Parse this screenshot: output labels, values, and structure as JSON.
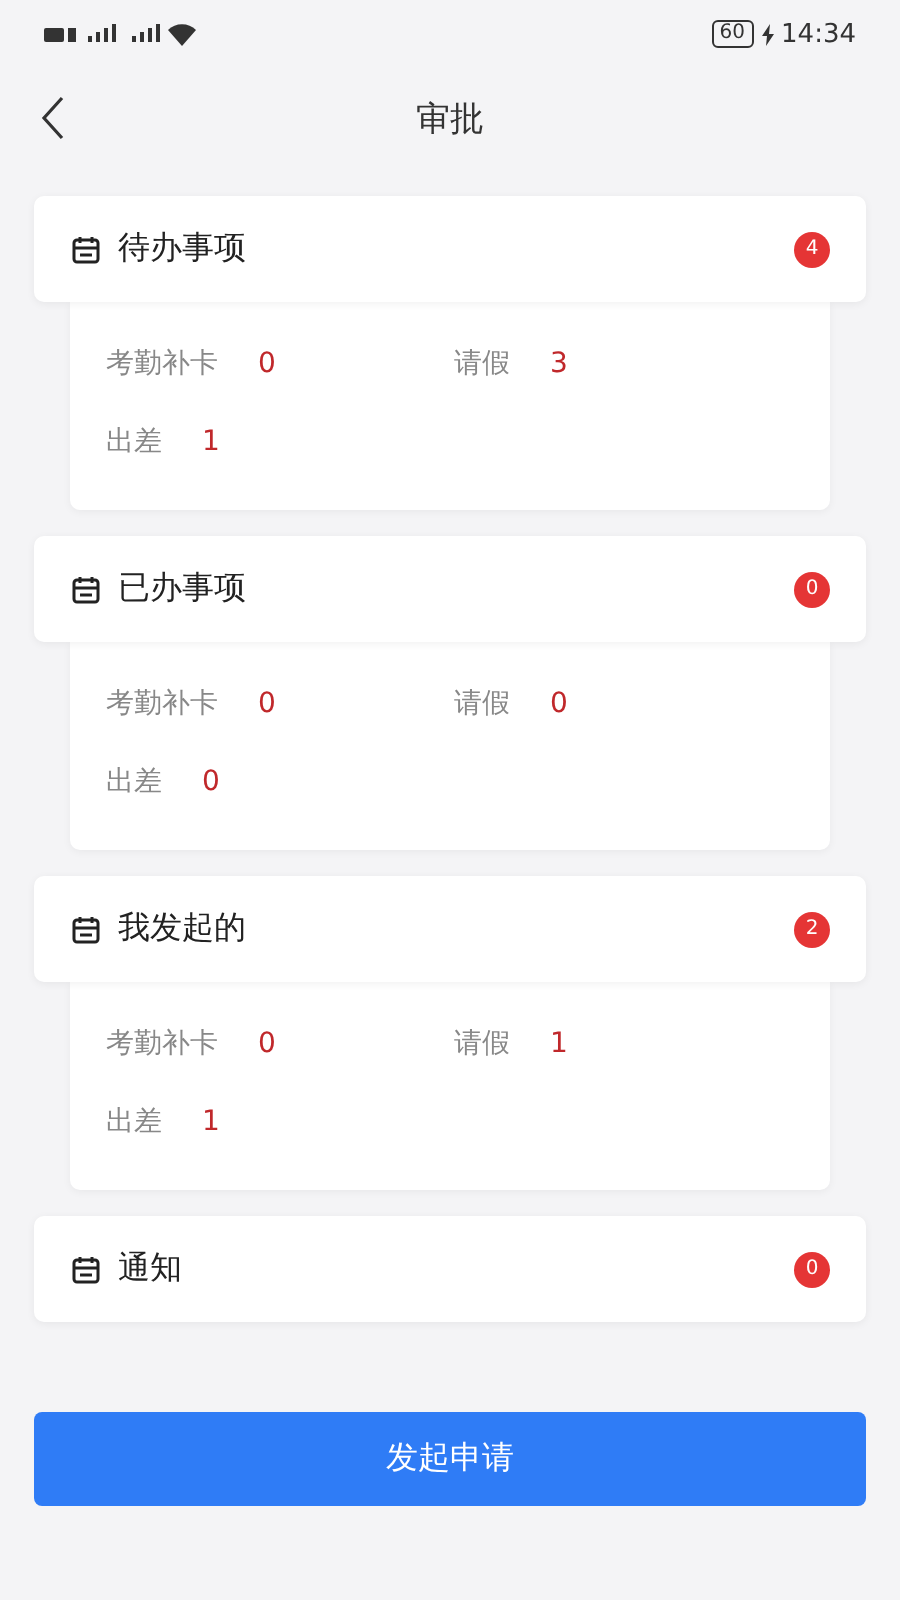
{
  "status_bar": {
    "battery": "60",
    "time": "14:34"
  },
  "header": {
    "title": "审批"
  },
  "sections": [
    {
      "title": "待办事项",
      "count": "4",
      "items": [
        {
          "label": "考勤补卡",
          "value": "0"
        },
        {
          "label": "请假",
          "value": "3"
        },
        {
          "label": "出差",
          "value": "1"
        }
      ]
    },
    {
      "title": "已办事项",
      "count": "0",
      "items": [
        {
          "label": "考勤补卡",
          "value": "0"
        },
        {
          "label": "请假",
          "value": "0"
        },
        {
          "label": "出差",
          "value": "0"
        }
      ]
    },
    {
      "title": "我发起的",
      "count": "2",
      "items": [
        {
          "label": "考勤补卡",
          "value": "0"
        },
        {
          "label": "请假",
          "value": "1"
        },
        {
          "label": "出差",
          "value": "1"
        }
      ]
    },
    {
      "title": "通知",
      "count": "0"
    }
  ],
  "submit_button": "发起申请"
}
